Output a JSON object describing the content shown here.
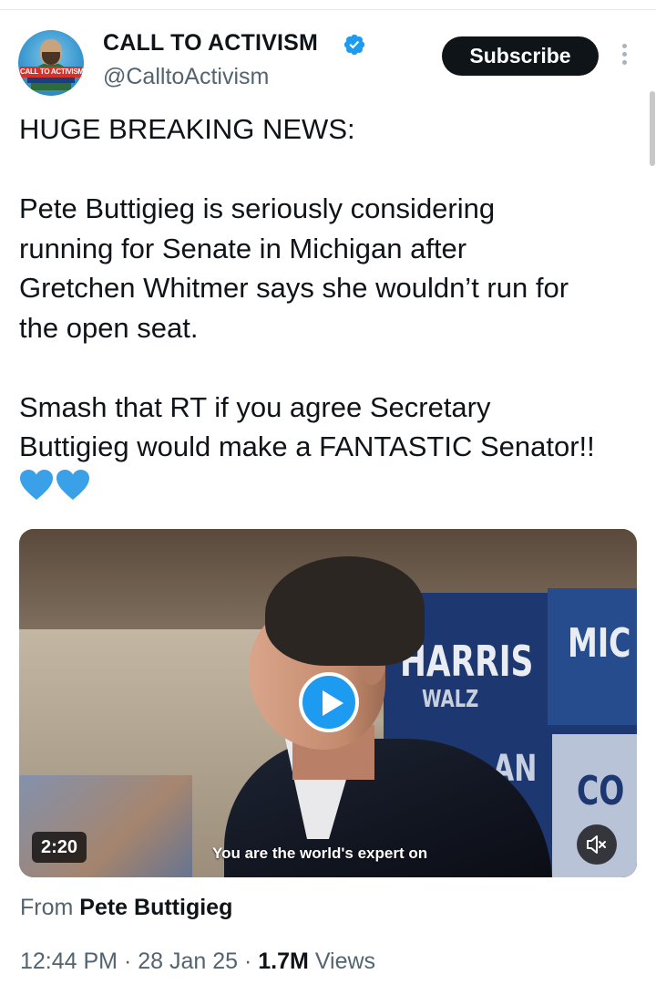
{
  "header": {
    "display_name": "CALL TO ACTIVISM",
    "handle": "@CalltoActivism",
    "avatar_text": "CALL TO ACTIVISM",
    "subscribe_label": "Subscribe",
    "verified_icon": "verified-badge-icon",
    "more_icon": "more-options-icon"
  },
  "tweet": {
    "line1": "HUGE BREAKING NEWS:",
    "paragraph2": "Pete Buttigieg is seriously considering\nrunning for Senate in Michigan after\nGretchen Whitmer says she wouldn’t run for\nthe open seat.",
    "paragraph3": "Smash that RT if you agree Secretary\nButtigieg would make a FANTASTIC Senator!!",
    "emoji": "💙💙"
  },
  "media": {
    "duration": "2:20",
    "caption": "You are the world's expert on",
    "sign_harris": "HARRIS",
    "sign_walz": "WALZ",
    "sign_mic": "MIC",
    "sign_an": "AN",
    "sign_co": "CO",
    "play_icon": "play-icon",
    "mute_icon": "muted-speaker-icon"
  },
  "attribution": {
    "prefix": "From ",
    "source": "Pete Buttigieg"
  },
  "meta": {
    "time": "12:44 PM",
    "separator": " · ",
    "date": "28 Jan 25",
    "views_count": "1.7M",
    "views_label": " Views"
  },
  "colors": {
    "accent": "#1d9bf0",
    "heart": "#3aa0e8",
    "text_primary": "#0f1419",
    "text_secondary": "#536471"
  }
}
